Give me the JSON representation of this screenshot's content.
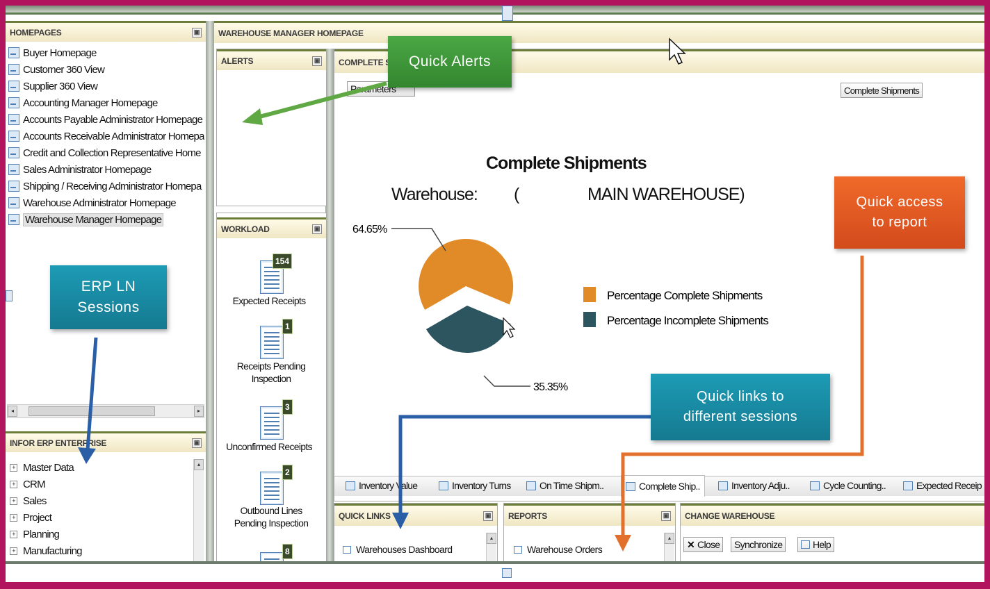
{
  "homepages": {
    "title": "HOMEPAGES",
    "items": [
      {
        "label": "Buyer Homepage"
      },
      {
        "label": "Customer 360 View"
      },
      {
        "label": "Supplier 360 View"
      },
      {
        "label": "Accounting Manager Homepage"
      },
      {
        "label": "Accounts Payable Administrator Homepage"
      },
      {
        "label": "Accounts Receivable Administrator Homepa"
      },
      {
        "label": "Credit and Collection Representative Home"
      },
      {
        "label": "Sales Administrator Homepage"
      },
      {
        "label": "Shipping / Receiving Administrator Homepa"
      },
      {
        "label": "Warehouse Administrator Homepage"
      },
      {
        "label": "Warehouse Manager Homepage",
        "selected": true
      }
    ]
  },
  "infor": {
    "title": "INFOR ERP ENTERPRISE",
    "items": [
      {
        "label": "Master Data"
      },
      {
        "label": "CRM"
      },
      {
        "label": "Sales"
      },
      {
        "label": "Project"
      },
      {
        "label": "Planning"
      },
      {
        "label": "Manufacturing"
      }
    ]
  },
  "main": {
    "title": "WAREHOUSE MANAGER HOMEPAGE"
  },
  "alerts": {
    "title": "ALERTS"
  },
  "workload": {
    "title": "WORKLOAD",
    "items": [
      {
        "count": "154",
        "label": "Expected Receipts"
      },
      {
        "count": "1",
        "label": "Receipts Pending Inspection"
      },
      {
        "count": "3",
        "label": "Unconfirmed Receipts"
      },
      {
        "count": "2",
        "label": "Outbound Lines Pending Inspection"
      },
      {
        "count": "8",
        "label": ""
      }
    ]
  },
  "report": {
    "header": "COMPLETE S",
    "parameters_label": "Parameters",
    "report_button": "Complete Shipments",
    "tabs": [
      {
        "label": "Inventory Value"
      },
      {
        "label": "Inventory Turns"
      },
      {
        "label": "On Time Shipm.."
      },
      {
        "label": "Complete Ship..",
        "active": true
      },
      {
        "label": "Inventory Adju.."
      },
      {
        "label": "Cycle Counting.."
      },
      {
        "label": "Expected Receip"
      }
    ]
  },
  "chart_data": {
    "type": "pie",
    "title": "Complete Shipments",
    "subtitle_label": "Warehouse:",
    "subtitle_open": "(",
    "subtitle_value": "MAIN WAREHOUSE)",
    "slices": [
      {
        "name": "Percentage Complete Shipments",
        "value": 64.65,
        "label": "64.65%",
        "color": "#e08a28"
      },
      {
        "name": "Percentage Incomplete Shipments",
        "value": 35.35,
        "label": "35.35%",
        "color": "#2d5560"
      }
    ],
    "legend_position": "right"
  },
  "quick_links": {
    "title": "QUICK LINKS",
    "items": [
      {
        "label": "Warehouses Dashboard"
      }
    ]
  },
  "reports": {
    "title": "REPORTS",
    "items": [
      {
        "label": "Warehouse Orders"
      }
    ]
  },
  "change_warehouse": {
    "title": "CHANGE WAREHOUSE",
    "close_label": "Close",
    "sync_label": "Synchronize",
    "help_label": "Help"
  },
  "callouts": {
    "quick_alerts": "Quick Alerts",
    "erp_ln_line1": "ERP LN",
    "erp_ln_line2": "Sessions",
    "quick_access_line1": "Quick access",
    "quick_access_line2": "to report",
    "quick_links_line1": "Quick links to",
    "quick_links_line2": "different sessions"
  },
  "colors": {
    "border": "#b0155d",
    "green_callout": "#3f9a3a",
    "teal_callout": "#1a8ea6",
    "orange_callout": "#e25a24",
    "blue_arrow": "#2a5fa8",
    "orange_arrow": "#e2712d"
  }
}
